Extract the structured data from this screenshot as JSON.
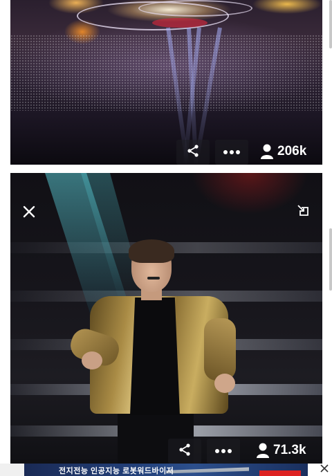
{
  "feed": {
    "cards": [
      {
        "media_description": "concert-arena",
        "actions": {
          "share_icon": "share-icon",
          "more_icon": "more-horizontal-icon"
        },
        "views": {
          "icon": "user-icon",
          "count": "206k"
        }
      },
      {
        "media_description": "performer-on-stage",
        "actions": {
          "share_icon": "share-icon",
          "more_icon": "more-horizontal-icon"
        },
        "views": {
          "icon": "user-icon",
          "count": "71.3k"
        },
        "overlay": {
          "close_icon": "close-icon",
          "corner_icon": "popout-icon"
        }
      }
    ]
  },
  "ad_banner": {
    "text": "전지전능 인공지능 로봇워드바이저",
    "close_icon": "close-icon"
  },
  "colors": {
    "overlay_button_bg": "#1e1e23",
    "text_on_media": "#ffffff",
    "ad_bg": "#22407a"
  }
}
